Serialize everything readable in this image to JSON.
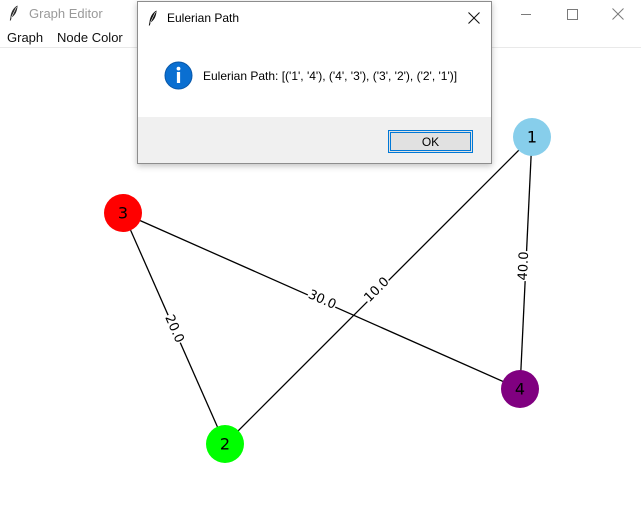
{
  "window": {
    "title": "Graph Editor",
    "minimize_icon": "minimize-icon",
    "maximize_icon": "maximize-icon",
    "close_icon": "close-icon"
  },
  "menu": {
    "items": [
      {
        "label": "Graph"
      },
      {
        "label": "Node Color"
      }
    ]
  },
  "graph": {
    "nodes": [
      {
        "id": "1",
        "label": "1",
        "color": "#87ceeb"
      },
      {
        "id": "2",
        "label": "2",
        "color": "#00ff00"
      },
      {
        "id": "3",
        "label": "3",
        "color": "#ff0000"
      },
      {
        "id": "4",
        "label": "4",
        "color": "#800080"
      }
    ],
    "edges": [
      {
        "from": "1",
        "to": "2",
        "weight": "10.0"
      },
      {
        "from": "1",
        "to": "4",
        "weight": "40.0"
      },
      {
        "from": "3",
        "to": "2",
        "weight": "20.0"
      },
      {
        "from": "3",
        "to": "4",
        "weight": "30.0"
      }
    ]
  },
  "dialog": {
    "title": "Eulerian Path",
    "message": "Eulerian Path: [('1', '4'), ('4', '3'), ('3', '2'), ('2', '1')]",
    "ok_label": "OK",
    "accent_color": "#0078d7",
    "icon": "info-icon"
  }
}
